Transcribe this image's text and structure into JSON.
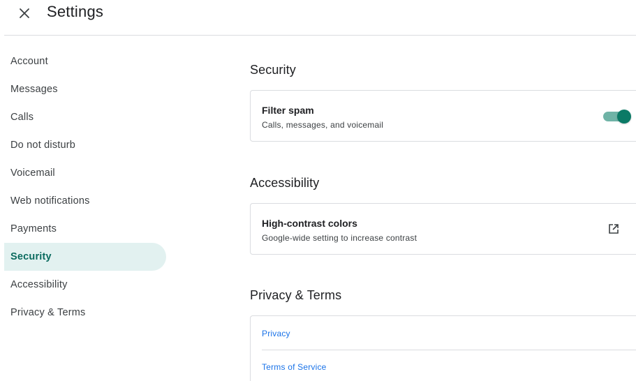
{
  "header": {
    "title": "Settings",
    "close_icon": "close-icon"
  },
  "sidebar": {
    "items": [
      {
        "label": "Account"
      },
      {
        "label": "Messages"
      },
      {
        "label": "Calls"
      },
      {
        "label": "Do not disturb"
      },
      {
        "label": "Voicemail"
      },
      {
        "label": "Web notifications"
      },
      {
        "label": "Payments"
      },
      {
        "label": "Security",
        "active": true
      },
      {
        "label": "Accessibility"
      },
      {
        "label": "Privacy & Terms"
      }
    ]
  },
  "sections": {
    "security": {
      "title": "Security",
      "filter_spam": {
        "title": "Filter spam",
        "subtitle": "Calls, messages, and voicemail",
        "enabled": true
      }
    },
    "accessibility": {
      "title": "Accessibility",
      "high_contrast": {
        "title": "High-contrast colors",
        "subtitle": "Google-wide setting to increase contrast",
        "icon": "open-in-new-icon"
      }
    },
    "privacy": {
      "title": "Privacy & Terms",
      "links": [
        {
          "label": "Privacy"
        },
        {
          "label": "Terms of Service"
        }
      ]
    }
  },
  "colors": {
    "accent": "#0b7a66",
    "active_nav_bg": "#e2f1f0",
    "active_nav_text": "#0b6b5f",
    "link": "#1a73e8",
    "divider": "#dadce0"
  }
}
